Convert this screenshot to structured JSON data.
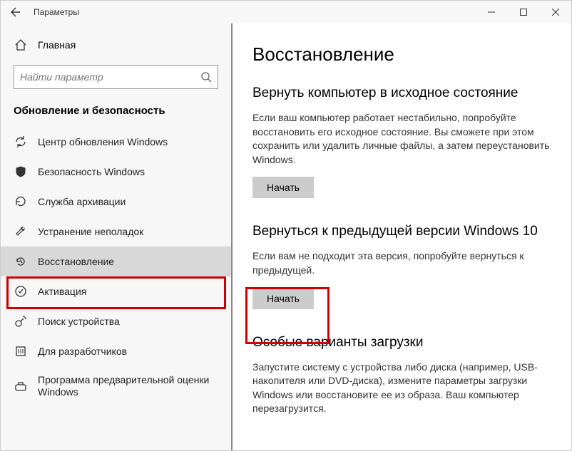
{
  "titlebar": {
    "title": "Параметры"
  },
  "home": {
    "label": "Главная"
  },
  "search": {
    "placeholder": "Найти параметр"
  },
  "section_header": "Обновление и безопасность",
  "nav": [
    {
      "label": "Центр обновления Windows"
    },
    {
      "label": "Безопасность Windows"
    },
    {
      "label": "Служба архивации"
    },
    {
      "label": "Устранение неполадок"
    },
    {
      "label": "Восстановление"
    },
    {
      "label": "Активация"
    },
    {
      "label": "Поиск устройства"
    },
    {
      "label": "Для разработчиков"
    },
    {
      "label": "Программа предварительной оценки Windows"
    }
  ],
  "main": {
    "title": "Восстановление",
    "reset": {
      "title": "Вернуть компьютер в исходное состояние",
      "desc": "Если ваш компьютер работает нестабильно, попробуйте восстановить его исходное состояние. Вы сможете при этом сохранить или удалить личные файлы, а затем переустановить Windows.",
      "button": "Начать"
    },
    "goback": {
      "title": "Вернуться к предыдущей версии Windows 10",
      "desc": "Если вам не подходит эта версия, попробуйте вернуться к предыдущей.",
      "button": "Начать"
    },
    "advanced": {
      "title": "Особые варианты загрузки",
      "desc": "Запустите систему с устройства либо диска (например, USB-накопителя или DVD-диска), измените параметры загрузки Windows или восстановите ее из образа. Ваш компьютер перезагрузится."
    }
  }
}
